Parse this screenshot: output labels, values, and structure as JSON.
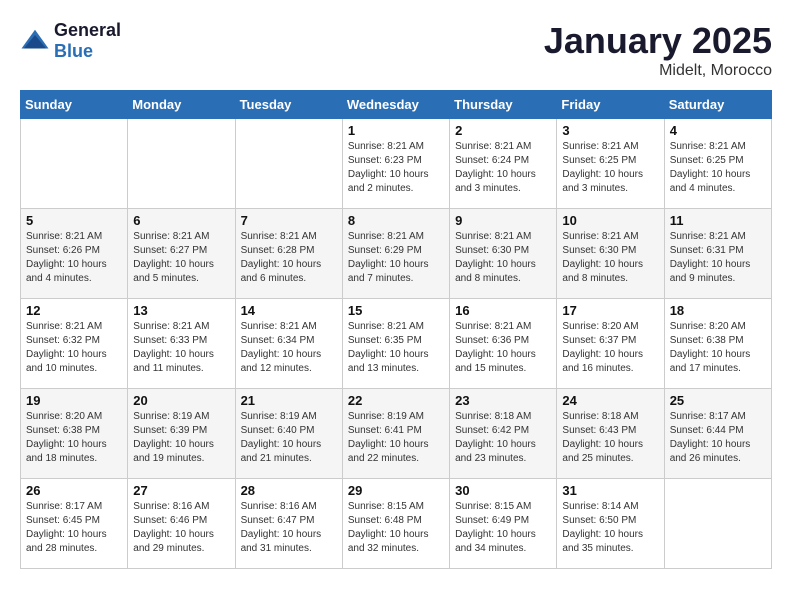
{
  "header": {
    "logo_line1": "General",
    "logo_line2": "Blue",
    "month": "January 2025",
    "location": "Midelt, Morocco"
  },
  "weekdays": [
    "Sunday",
    "Monday",
    "Tuesday",
    "Wednesday",
    "Thursday",
    "Friday",
    "Saturday"
  ],
  "weeks": [
    [
      {
        "day": "",
        "info": ""
      },
      {
        "day": "",
        "info": ""
      },
      {
        "day": "",
        "info": ""
      },
      {
        "day": "1",
        "info": "Sunrise: 8:21 AM\nSunset: 6:23 PM\nDaylight: 10 hours\nand 2 minutes."
      },
      {
        "day": "2",
        "info": "Sunrise: 8:21 AM\nSunset: 6:24 PM\nDaylight: 10 hours\nand 3 minutes."
      },
      {
        "day": "3",
        "info": "Sunrise: 8:21 AM\nSunset: 6:25 PM\nDaylight: 10 hours\nand 3 minutes."
      },
      {
        "day": "4",
        "info": "Sunrise: 8:21 AM\nSunset: 6:25 PM\nDaylight: 10 hours\nand 4 minutes."
      }
    ],
    [
      {
        "day": "5",
        "info": "Sunrise: 8:21 AM\nSunset: 6:26 PM\nDaylight: 10 hours\nand 4 minutes."
      },
      {
        "day": "6",
        "info": "Sunrise: 8:21 AM\nSunset: 6:27 PM\nDaylight: 10 hours\nand 5 minutes."
      },
      {
        "day": "7",
        "info": "Sunrise: 8:21 AM\nSunset: 6:28 PM\nDaylight: 10 hours\nand 6 minutes."
      },
      {
        "day": "8",
        "info": "Sunrise: 8:21 AM\nSunset: 6:29 PM\nDaylight: 10 hours\nand 7 minutes."
      },
      {
        "day": "9",
        "info": "Sunrise: 8:21 AM\nSunset: 6:30 PM\nDaylight: 10 hours\nand 8 minutes."
      },
      {
        "day": "10",
        "info": "Sunrise: 8:21 AM\nSunset: 6:30 PM\nDaylight: 10 hours\nand 8 minutes."
      },
      {
        "day": "11",
        "info": "Sunrise: 8:21 AM\nSunset: 6:31 PM\nDaylight: 10 hours\nand 9 minutes."
      }
    ],
    [
      {
        "day": "12",
        "info": "Sunrise: 8:21 AM\nSunset: 6:32 PM\nDaylight: 10 hours\nand 10 minutes."
      },
      {
        "day": "13",
        "info": "Sunrise: 8:21 AM\nSunset: 6:33 PM\nDaylight: 10 hours\nand 11 minutes."
      },
      {
        "day": "14",
        "info": "Sunrise: 8:21 AM\nSunset: 6:34 PM\nDaylight: 10 hours\nand 12 minutes."
      },
      {
        "day": "15",
        "info": "Sunrise: 8:21 AM\nSunset: 6:35 PM\nDaylight: 10 hours\nand 13 minutes."
      },
      {
        "day": "16",
        "info": "Sunrise: 8:21 AM\nSunset: 6:36 PM\nDaylight: 10 hours\nand 15 minutes."
      },
      {
        "day": "17",
        "info": "Sunrise: 8:20 AM\nSunset: 6:37 PM\nDaylight: 10 hours\nand 16 minutes."
      },
      {
        "day": "18",
        "info": "Sunrise: 8:20 AM\nSunset: 6:38 PM\nDaylight: 10 hours\nand 17 minutes."
      }
    ],
    [
      {
        "day": "19",
        "info": "Sunrise: 8:20 AM\nSunset: 6:38 PM\nDaylight: 10 hours\nand 18 minutes."
      },
      {
        "day": "20",
        "info": "Sunrise: 8:19 AM\nSunset: 6:39 PM\nDaylight: 10 hours\nand 19 minutes."
      },
      {
        "day": "21",
        "info": "Sunrise: 8:19 AM\nSunset: 6:40 PM\nDaylight: 10 hours\nand 21 minutes."
      },
      {
        "day": "22",
        "info": "Sunrise: 8:19 AM\nSunset: 6:41 PM\nDaylight: 10 hours\nand 22 minutes."
      },
      {
        "day": "23",
        "info": "Sunrise: 8:18 AM\nSunset: 6:42 PM\nDaylight: 10 hours\nand 23 minutes."
      },
      {
        "day": "24",
        "info": "Sunrise: 8:18 AM\nSunset: 6:43 PM\nDaylight: 10 hours\nand 25 minutes."
      },
      {
        "day": "25",
        "info": "Sunrise: 8:17 AM\nSunset: 6:44 PM\nDaylight: 10 hours\nand 26 minutes."
      }
    ],
    [
      {
        "day": "26",
        "info": "Sunrise: 8:17 AM\nSunset: 6:45 PM\nDaylight: 10 hours\nand 28 minutes."
      },
      {
        "day": "27",
        "info": "Sunrise: 8:16 AM\nSunset: 6:46 PM\nDaylight: 10 hours\nand 29 minutes."
      },
      {
        "day": "28",
        "info": "Sunrise: 8:16 AM\nSunset: 6:47 PM\nDaylight: 10 hours\nand 31 minutes."
      },
      {
        "day": "29",
        "info": "Sunrise: 8:15 AM\nSunset: 6:48 PM\nDaylight: 10 hours\nand 32 minutes."
      },
      {
        "day": "30",
        "info": "Sunrise: 8:15 AM\nSunset: 6:49 PM\nDaylight: 10 hours\nand 34 minutes."
      },
      {
        "day": "31",
        "info": "Sunrise: 8:14 AM\nSunset: 6:50 PM\nDaylight: 10 hours\nand 35 minutes."
      },
      {
        "day": "",
        "info": ""
      }
    ]
  ]
}
